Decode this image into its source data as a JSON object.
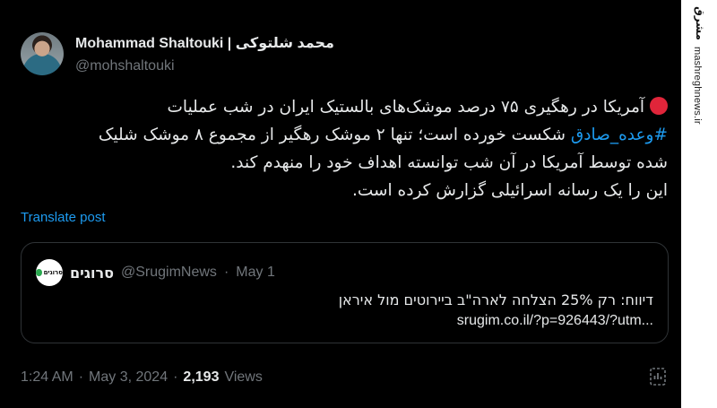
{
  "tweet": {
    "display_name": "Mohammad Shaltouki | محمد شلتوکی",
    "handle": "@mohshaltouki",
    "body_line1": "آمریکا در رهگیری ۷۵ درصد موشک‌های بالستیک ایران در شب عملیات",
    "hashtag": "#وعده_صادق",
    "body_line2_rest": " شکست خورده است؛ تنها ۲ موشک رهگیر از مجموع ۸ موشک شلیک",
    "body_line3": "شده توسط آمریکا در آن شب توانسته اهداف خود را منهدم کند.",
    "body_line4": "این را یک رسانه اسرائیلی گزارش کرده است.",
    "translate_label": "Translate post"
  },
  "quote": {
    "logo_text": "סרוגים",
    "name": "סרוגים",
    "handle": "@SrugimNews",
    "separator": "·",
    "date": "May 1",
    "text": "דיווח: רק 25% הצלחה לארה\"ב ביירוטים מול איראן",
    "url": "srugim.co.il/?p=926443/?utm..."
  },
  "meta": {
    "time": "1:24 AM",
    "separator": "·",
    "date": "May 3, 2024",
    "views_count": "2,193",
    "views_label": "Views"
  },
  "watermark": {
    "logo_text": "مشرق",
    "site": "mashreghnews.ir"
  },
  "colors": {
    "background": "#000000",
    "text": "#e7e9ea",
    "secondary": "#71767b",
    "link": "#1d9bf0",
    "border": "#2f3336",
    "red_emoji": "#e0253a"
  }
}
